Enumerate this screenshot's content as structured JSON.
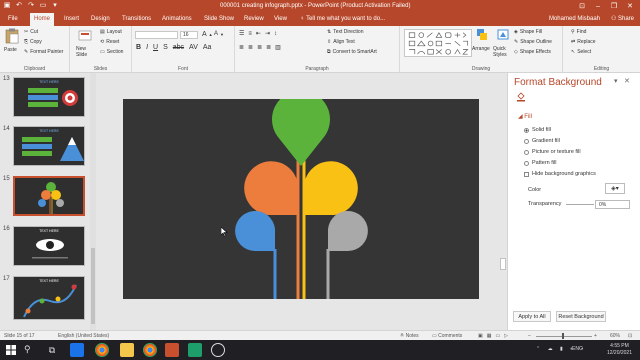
{
  "app": {
    "title": "000001 creating infograph.pptx - PowerPoint (Product Activation Failed)",
    "user": "Mohamed Misbaah",
    "share": "Share",
    "tell_me": "Tell me what you want to do..."
  },
  "tabs": [
    {
      "label": "File"
    },
    {
      "label": "Home"
    },
    {
      "label": "Insert"
    },
    {
      "label": "Design"
    },
    {
      "label": "Transitions"
    },
    {
      "label": "Animations"
    },
    {
      "label": "Slide Show"
    },
    {
      "label": "Review"
    },
    {
      "label": "View"
    }
  ],
  "ribbon": {
    "clipboard": {
      "label": "Clipboard",
      "paste": "Paste",
      "cut": "Cut",
      "copy": "Copy",
      "format_painter": "Format Painter"
    },
    "slides": {
      "label": "Slides",
      "new_slide": "New Slide",
      "layout": "Layout",
      "reset": "Reset",
      "section": "Section"
    },
    "font": {
      "label": "Font",
      "size": "16"
    },
    "paragraph": {
      "label": "Paragraph",
      "text_direction": "Text Direction",
      "align_text": "Align Text",
      "smartart": "Convert to SmartArt"
    },
    "drawing": {
      "label": "Drawing",
      "arrange": "Arrange",
      "quick_styles": "Quick Styles",
      "shape_fill": "Shape Fill",
      "shape_outline": "Shape Outline",
      "shape_effects": "Shape Effects"
    },
    "editing": {
      "label": "Editing",
      "find": "Find",
      "replace": "Replace",
      "select": "Select"
    }
  },
  "thumbnails": [
    {
      "num": "13",
      "title": "TEXT HERE"
    },
    {
      "num": "14",
      "title": "TEXT HERE"
    },
    {
      "num": "15",
      "title": ""
    },
    {
      "num": "16",
      "title": "TEXT HERE"
    },
    {
      "num": "17",
      "title": "TEXT HERE"
    }
  ],
  "pane": {
    "title": "Format Background",
    "section": "Fill",
    "options": {
      "solid": "Solid fill",
      "gradient": "Gradient fill",
      "picture": "Picture or texture fill",
      "pattern": "Pattern fill",
      "hide": "Hide background graphics"
    },
    "color_label": "Color",
    "transparency_label": "Transparency",
    "transparency_value": "0%",
    "apply_all": "Apply to All",
    "reset_bg": "Reset Background"
  },
  "status": {
    "slide": "Slide 15 of 17",
    "language": "English (United States)",
    "notes": "Notes",
    "comments": "Comments",
    "zoom": "60%"
  },
  "taskbar": {
    "lang": "ENG",
    "time": "4:55 PM",
    "date": "12/20/2021"
  },
  "colors": {
    "accent": "#b7472a",
    "slide_bg": "#353536",
    "green": "#5bb33b",
    "orange": "#ec7d3c",
    "yellow": "#f8c114",
    "blue": "#4a90d8",
    "gray": "#a9a9a9"
  }
}
